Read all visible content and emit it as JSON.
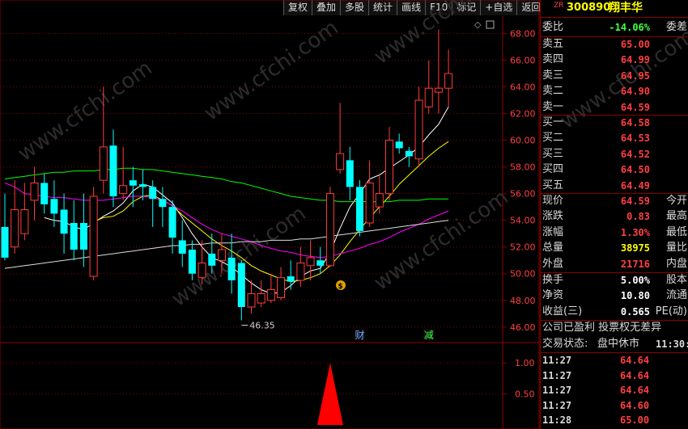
{
  "toolbar": [
    "复权",
    "叠加",
    "多股",
    "统计",
    "画线",
    "F10",
    "标记",
    "+自选",
    "返回"
  ],
  "header": {
    "prefix": "ZR",
    "code": "300890",
    "name": "翔丰华"
  },
  "weibi": {
    "label": "委比",
    "value": "-14.06%",
    "label2": "委差"
  },
  "asks": [
    {
      "label": "卖五",
      "price": "65.00"
    },
    {
      "label": "卖四",
      "price": "64.99"
    },
    {
      "label": "卖三",
      "price": "64.95"
    },
    {
      "label": "卖二",
      "price": "64.90"
    },
    {
      "label": "卖一",
      "price": "64.59"
    }
  ],
  "bids": [
    {
      "label": "买一",
      "price": "64.58"
    },
    {
      "label": "买二",
      "price": "64.53"
    },
    {
      "label": "买三",
      "price": "64.52"
    },
    {
      "label": "买四",
      "price": "64.50"
    },
    {
      "label": "买五",
      "price": "64.49"
    }
  ],
  "stats": [
    {
      "label": "现价",
      "value": "64.59",
      "label2": "今开",
      "color": "red"
    },
    {
      "label": "涨跌",
      "value": "0.83",
      "label2": "最高",
      "color": "red"
    },
    {
      "label": "涨幅",
      "value": "1.30%",
      "label2": "最低",
      "color": "red"
    },
    {
      "label": "总量",
      "value": "38975",
      "label2": "量比",
      "color": "yellow"
    },
    {
      "label": "外盘",
      "value": "21716",
      "label2": "内盘",
      "color": "red"
    }
  ],
  "stats2": [
    {
      "label": "换手",
      "value": "5.00%",
      "label2": "股本"
    },
    {
      "label": "净资",
      "value": "10.80",
      "label2": "流通"
    },
    {
      "label": "收益(三)",
      "value": "0.565",
      "label2": "PE(动)"
    }
  ],
  "notice": "公司已盈利 投票权无差异",
  "status": {
    "label": "交易状态:",
    "value": "盘中休市",
    "time": "11:30:"
  },
  "ticks": [
    {
      "time": "11:27",
      "price": "64.64"
    },
    {
      "time": "11:27",
      "price": "64.64"
    },
    {
      "time": "11:27",
      "price": "64.64"
    },
    {
      "time": "11:27",
      "price": "64.60"
    },
    {
      "time": "11:28",
      "price": "65.00"
    }
  ],
  "watermark": "www.cfchi.com",
  "colors": {
    "up": "#ff3c3c",
    "down": "#00ffff",
    "ma1": "#ffffff",
    "ma2": "#ffff00",
    "ma3": "#ff00ff",
    "ma4": "#00ff00",
    "grid": "#8b0000",
    "axis_text": "#ff4040"
  },
  "chart_data": {
    "type": "candlestick",
    "y_ticks": [
      "68.00",
      "66.00",
      "64.00",
      "62.00",
      "60.00",
      "58.00",
      "56.00",
      "54.00",
      "52.00",
      "50.00",
      "48.00",
      "46.00"
    ],
    "ylim": [
      45.2,
      69.3
    ],
    "candles": [
      {
        "o": 53.5,
        "c": 51.2,
        "h": 56.0,
        "l": 51.0
      },
      {
        "o": 52.0,
        "c": 54.8,
        "h": 57.0,
        "l": 51.5
      },
      {
        "o": 53.0,
        "c": 54.8,
        "h": 56.8,
        "l": 52.5
      },
      {
        "o": 55.5,
        "c": 56.8,
        "h": 58.0,
        "l": 54.0
      },
      {
        "o": 56.8,
        "c": 55.2,
        "h": 57.5,
        "l": 54.5
      },
      {
        "o": 55.6,
        "c": 54.5,
        "h": 57.0,
        "l": 53.5
      },
      {
        "o": 54.8,
        "c": 53.0,
        "h": 56.0,
        "l": 51.5
      },
      {
        "o": 53.8,
        "c": 51.8,
        "h": 55.5,
        "l": 51.0
      },
      {
        "o": 53.8,
        "c": 51.8,
        "h": 56.0,
        "l": 50.5
      },
      {
        "o": 49.8,
        "c": 55.8,
        "h": 56.5,
        "l": 49.5
      },
      {
        "o": 57.0,
        "c": 59.5,
        "h": 64.0,
        "l": 56.0
      },
      {
        "o": 59.6,
        "c": 55.8,
        "h": 60.8,
        "l": 55.0
      },
      {
        "o": 56.0,
        "c": 56.6,
        "h": 59.5,
        "l": 55.5
      },
      {
        "o": 57.0,
        "c": 56.6,
        "h": 58.0,
        "l": 55.0
      },
      {
        "o": 56.7,
        "c": 56.5,
        "h": 57.8,
        "l": 55.5
      },
      {
        "o": 56.5,
        "c": 55.6,
        "h": 57.0,
        "l": 53.5
      },
      {
        "o": 55.6,
        "c": 55.0,
        "h": 56.5,
        "l": 53.5
      },
      {
        "o": 55.0,
        "c": 52.7,
        "h": 55.5,
        "l": 51.5
      },
      {
        "o": 52.5,
        "c": 51.5,
        "h": 54.0,
        "l": 50.5
      },
      {
        "o": 51.8,
        "c": 50.0,
        "h": 52.5,
        "l": 49.5
      },
      {
        "o": 49.7,
        "c": 50.8,
        "h": 52.5,
        "l": 49.2
      },
      {
        "o": 51.5,
        "c": 50.6,
        "h": 53.0,
        "l": 50.0
      },
      {
        "o": 51.0,
        "c": 51.8,
        "h": 53.0,
        "l": 50.0
      },
      {
        "o": 51.2,
        "c": 49.5,
        "h": 53.0,
        "l": 48.5
      },
      {
        "o": 50.8,
        "c": 47.5,
        "h": 51.0,
        "l": 46.5
      },
      {
        "o": 47.5,
        "c": 48.5,
        "h": 49.5,
        "l": 47.0
      },
      {
        "o": 47.8,
        "c": 48.5,
        "h": 49.5,
        "l": 47.5
      },
      {
        "o": 48.0,
        "c": 48.8,
        "h": 50.0,
        "l": 47.8
      },
      {
        "o": 48.2,
        "c": 49.7,
        "h": 50.5,
        "l": 48.0
      },
      {
        "o": 49.8,
        "c": 49.4,
        "h": 51.0,
        "l": 48.8
      },
      {
        "o": 49.5,
        "c": 50.8,
        "h": 52.0,
        "l": 49.0
      },
      {
        "o": 50.6,
        "c": 51.2,
        "h": 52.5,
        "l": 49.5
      },
      {
        "o": 51.0,
        "c": 50.6,
        "h": 52.0,
        "l": 50.0
      },
      {
        "o": 50.6,
        "c": 56.0,
        "h": 56.5,
        "l": 50.5
      },
      {
        "o": 57.8,
        "c": 59.0,
        "h": 62.8,
        "l": 57.5
      },
      {
        "o": 58.5,
        "c": 56.5,
        "h": 59.5,
        "l": 55.5
      },
      {
        "o": 56.5,
        "c": 53.2,
        "h": 57.0,
        "l": 52.8
      },
      {
        "o": 53.8,
        "c": 56.8,
        "h": 58.5,
        "l": 53.5
      },
      {
        "o": 55.0,
        "c": 56.0,
        "h": 57.5,
        "l": 54.5
      },
      {
        "o": 56.0,
        "c": 60.0,
        "h": 61.0,
        "l": 55.5
      },
      {
        "o": 59.9,
        "c": 59.4,
        "h": 60.5,
        "l": 59.0
      },
      {
        "o": 59.2,
        "c": 58.8,
        "h": 59.5,
        "l": 58.0
      },
      {
        "o": 58.6,
        "c": 63.0,
        "h": 64.0,
        "l": 58.0
      },
      {
        "o": 62.5,
        "c": 63.9,
        "h": 66.0,
        "l": 62.0
      },
      {
        "o": 63.6,
        "c": 63.9,
        "h": 68.3,
        "l": 62.0
      },
      {
        "o": 63.9,
        "c": 65.0,
        "h": 66.8,
        "l": 62.5
      }
    ],
    "ma_lines": [
      {
        "color": "white",
        "values": [
          null,
          null,
          null,
          null,
          54.2,
          54.0,
          53.9,
          53.5,
          53.3,
          53.8,
          54.3,
          54.7,
          55.3,
          56.2,
          56.7,
          56.5,
          55.9,
          55.3,
          54.2,
          53.0,
          52.0,
          51.2,
          50.9,
          50.5,
          49.9,
          49.3,
          48.8,
          48.5,
          48.6,
          49.1,
          49.8,
          50.2,
          50.4,
          51.6,
          53.4,
          55.0,
          56.0,
          57.1,
          57.4,
          57.9,
          58.4,
          58.9,
          59.5,
          60.4,
          61.2,
          62.5
        ]
      },
      {
        "color": "yellow",
        "values": [
          null,
          null,
          null,
          null,
          null,
          null,
          null,
          null,
          null,
          53.9,
          54.2,
          54.3,
          54.7,
          55.4,
          55.8,
          55.9,
          55.5,
          55.1,
          54.4,
          53.8,
          53.2,
          52.6,
          52.1,
          51.7,
          51.2,
          50.6,
          50.2,
          49.9,
          49.6,
          49.4,
          49.5,
          49.7,
          50.0,
          50.6,
          51.4,
          52.4,
          53.3,
          54.2,
          55.0,
          55.8,
          56.7,
          57.4,
          58.1,
          58.8,
          59.4,
          59.9
        ]
      },
      {
        "color": "magenta",
        "values": [
          56.8,
          56.5,
          56.0,
          55.9,
          55.8,
          55.7,
          55.7,
          55.6,
          55.5,
          55.5,
          55.5,
          55.6,
          55.7,
          55.8,
          55.8,
          55.7,
          55.5,
          55.1,
          54.7,
          54.2,
          53.7,
          53.3,
          53.0,
          52.8,
          52.6,
          52.4,
          52.1,
          51.9,
          51.7,
          51.6,
          51.4,
          51.3,
          51.2,
          51.3,
          51.5,
          51.7,
          51.9,
          52.2,
          52.4,
          52.7,
          53.1,
          53.4,
          53.7,
          54.1,
          54.4,
          54.7
        ]
      },
      {
        "color": "green",
        "values": [
          57.1,
          57.2,
          57.3,
          57.4,
          57.5,
          57.6,
          57.6,
          57.7,
          57.7,
          57.7,
          57.8,
          57.8,
          57.9,
          57.9,
          57.8,
          57.8,
          57.7,
          57.6,
          57.5,
          57.4,
          57.3,
          57.2,
          57.1,
          56.9,
          56.8,
          56.6,
          56.4,
          56.2,
          56.0,
          55.8,
          55.7,
          55.6,
          55.5,
          55.5,
          55.4,
          55.4,
          55.4,
          55.4,
          55.4,
          55.4,
          55.5,
          55.5,
          55.5,
          55.6,
          55.6,
          55.6
        ]
      },
      {
        "color": "light",
        "values": [
          50.4,
          50.5,
          50.6,
          50.7,
          50.8,
          50.9,
          51.0,
          51.1,
          51.2,
          51.3,
          51.4,
          51.5,
          51.6,
          51.7,
          51.8,
          51.9,
          52.0,
          52.1,
          52.1,
          52.2,
          52.2,
          52.3,
          52.3,
          52.3,
          52.4,
          52.4,
          52.4,
          52.5,
          52.5,
          52.5,
          52.6,
          52.6,
          52.7,
          52.8,
          52.9,
          53.0,
          53.1,
          53.2,
          53.3,
          53.4,
          53.5,
          53.6,
          53.7,
          53.8,
          53.9,
          54.0
        ]
      }
    ],
    "low_annotation": {
      "index": 24,
      "text": "46.35"
    },
    "markers": [
      {
        "index": 36,
        "text": "财",
        "color": "#6fa8ff"
      },
      {
        "index": 43,
        "text": "减",
        "color": "#40ff40"
      }
    ],
    "indicator": {
      "y_ticks": [
        "1.00",
        "0.50"
      ],
      "ylim": [
        0,
        1.25
      ],
      "spike_index": 33,
      "spike_value": 1.0
    }
  }
}
